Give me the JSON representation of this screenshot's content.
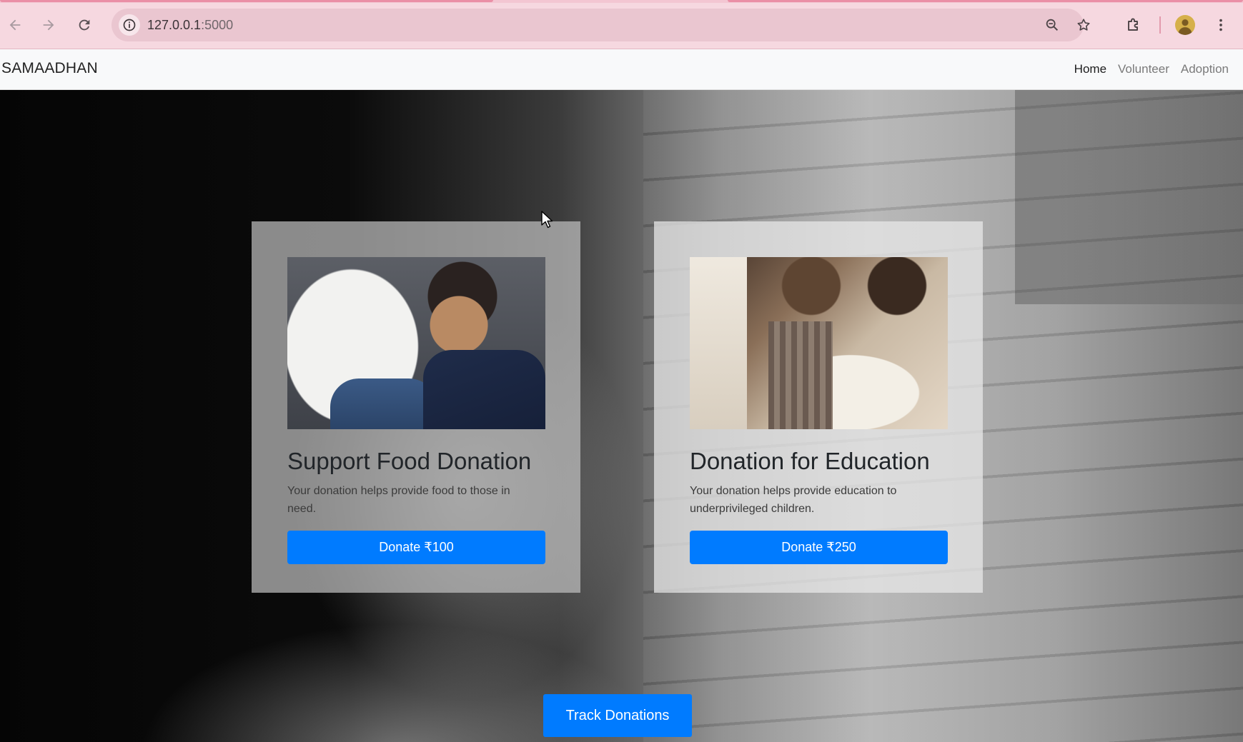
{
  "browser": {
    "url_host": "127.0.0.1",
    "url_port": ":5000"
  },
  "navbar": {
    "brand": "SAMAADHAN",
    "links": [
      {
        "label": "Home",
        "active": true
      },
      {
        "label": "Volunteer",
        "active": false
      },
      {
        "label": "Adoption",
        "active": false
      }
    ]
  },
  "cards": [
    {
      "title": "Support Food Donation",
      "description": "Your donation helps provide food to those in need.",
      "button": "Donate ₹100"
    },
    {
      "title": "Donation for Education",
      "description": "Your donation helps provide education to underprivileged children.",
      "button": "Donate ₹250"
    }
  ],
  "track_button": "Track Donations",
  "colors": {
    "primary": "#007bff",
    "navbar_bg": "#f8f9fa",
    "chrome_bg": "#f6d8e0"
  }
}
